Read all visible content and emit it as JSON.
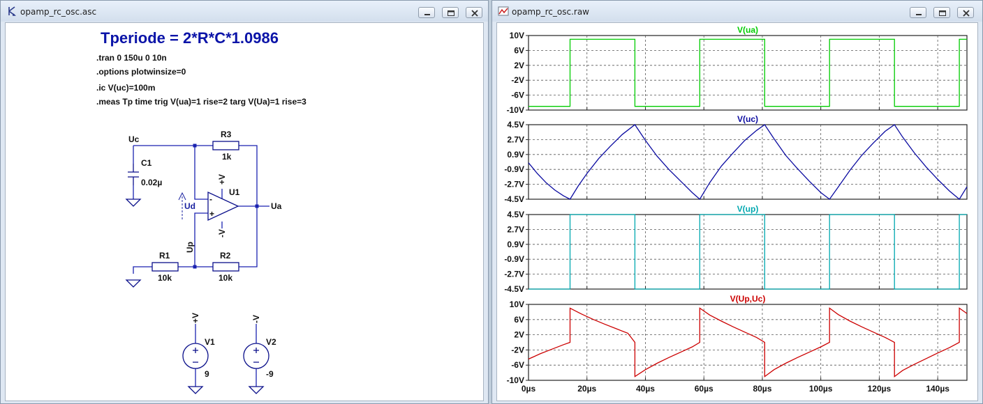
{
  "schematic_window": {
    "title": "opamp_rc_osc.asc",
    "app_icon": "ltspice-schematic-icon",
    "title_text": "Tperiode = 2*R*C*1.0986",
    "directives": [
      ".tran 0 150u 0 10n",
      ".options plotwinsize=0",
      ".ic V(uc)=100m",
      ".meas Tp time trig V(ua)=1 rise=2 targ V(Ua)=1 rise=3"
    ],
    "components": {
      "c1": {
        "name": "C1",
        "value": "0.02µ"
      },
      "r3": {
        "name": "R3",
        "value": "1k"
      },
      "r1": {
        "name": "R1",
        "value": "10k"
      },
      "r2": {
        "name": "R2",
        "value": "10k"
      },
      "u1": {
        "name": "U1",
        "plus_supply": "+V",
        "minus_supply": "-V",
        "in_plus": "+",
        "in_minus": "-"
      },
      "v1": {
        "name": "V1",
        "value": "9",
        "net": "+V"
      },
      "v2": {
        "name": "V2",
        "value": "-9",
        "net": "-V"
      }
    },
    "nets": {
      "uc": "Uc",
      "ua": "Ua",
      "up": "Up",
      "ud": "Ud"
    }
  },
  "waveform_window": {
    "title": "opamp_rc_osc.raw",
    "app_icon": "waveform-viewer-icon",
    "x_ticks": [
      "0µs",
      "20µs",
      "40µs",
      "60µs",
      "80µs",
      "100µs",
      "120µs",
      "140µs"
    ]
  },
  "chart_data": [
    {
      "type": "line",
      "title": "V(ua)",
      "color": "#00cc00",
      "xlim": [
        0,
        150
      ],
      "ylim": [
        -10,
        10
      ],
      "y_ticks": [
        "10V",
        "6V",
        "2V",
        "-2V",
        "-6V",
        "-10V"
      ],
      "y_tick_values": [
        10,
        6,
        2,
        -2,
        -6,
        -10
      ],
      "x_unit": "µs",
      "series": [
        {
          "x": [
            0,
            14.2,
            14.2,
            36.4,
            36.4,
            58.6,
            58.6,
            80.8,
            80.8,
            103,
            103,
            125.2,
            125.2,
            147.4,
            147.4,
            150
          ],
          "y": [
            -9,
            -9,
            9,
            9,
            -9,
            -9,
            9,
            9,
            -9,
            -9,
            9,
            9,
            -9,
            -9,
            9,
            9
          ]
        }
      ]
    },
    {
      "type": "line",
      "title": "V(uc)",
      "color": "#0a0aa0",
      "xlim": [
        0,
        150
      ],
      "ylim": [
        -4.5,
        4.5
      ],
      "y_ticks": [
        "4.5V",
        "2.7V",
        "0.9V",
        "-0.9V",
        "-2.7V",
        "-4.5V"
      ],
      "y_tick_values": [
        4.5,
        2.7,
        0.9,
        -0.9,
        -2.7,
        -4.5
      ],
      "x_unit": "µs",
      "series": [
        {
          "x": [
            0,
            3,
            6,
            9,
            12,
            14.2,
            17,
            20,
            24,
            28,
            32,
            36.4,
            40,
            44,
            48,
            52,
            56,
            58.6,
            62,
            66,
            70,
            74,
            78,
            80.8,
            84,
            88,
            92,
            96,
            100,
            103,
            106,
            110,
            114,
            118,
            122,
            125.2,
            128,
            132,
            136,
            140,
            144,
            147.4,
            150
          ],
          "y": [
            -0.1,
            -1.4,
            -2.5,
            -3.4,
            -4.1,
            -4.5,
            -2.9,
            -1.4,
            0.4,
            1.9,
            3.3,
            4.5,
            2.6,
            0.7,
            -0.9,
            -2.3,
            -3.7,
            -4.5,
            -2.5,
            -0.5,
            1.1,
            2.6,
            3.8,
            4.5,
            2.8,
            0.8,
            -0.8,
            -2.3,
            -3.7,
            -4.5,
            -3.0,
            -1.0,
            0.8,
            2.3,
            3.7,
            4.5,
            3.0,
            1.1,
            -0.6,
            -2.1,
            -3.5,
            -4.5,
            -3.0
          ]
        }
      ]
    },
    {
      "type": "line",
      "title": "V(up)",
      "color": "#00a8b0",
      "xlim": [
        0,
        150
      ],
      "ylim": [
        -4.5,
        4.5
      ],
      "y_ticks": [
        "4.5V",
        "2.7V",
        "0.9V",
        "-0.9V",
        "-2.7V",
        "-4.5V"
      ],
      "y_tick_values": [
        4.5,
        2.7,
        0.9,
        -0.9,
        -2.7,
        -4.5
      ],
      "x_unit": "µs",
      "series": [
        {
          "x": [
            0,
            14.2,
            14.2,
            36.4,
            36.4,
            58.6,
            58.6,
            80.8,
            80.8,
            103,
            103,
            125.2,
            125.2,
            147.4,
            147.4,
            150
          ],
          "y": [
            -4.5,
            -4.5,
            4.5,
            4.5,
            -4.5,
            -4.5,
            4.5,
            4.5,
            -4.5,
            -4.5,
            4.5,
            4.5,
            -4.5,
            -4.5,
            4.5,
            4.5
          ]
        }
      ]
    },
    {
      "type": "line",
      "title": "V(Up,Uc)",
      "color": "#cc0000",
      "xlim": [
        0,
        150
      ],
      "ylim": [
        -10,
        10
      ],
      "y_ticks": [
        "10V",
        "6V",
        "2V",
        "-2V",
        "-6V",
        "-10V"
      ],
      "y_tick_values": [
        10,
        6,
        2,
        -2,
        -6,
        -10
      ],
      "x_unit": "µs",
      "series": [
        {
          "x": [
            0,
            4,
            8,
            12,
            14.2,
            14.2,
            18,
            22,
            26,
            30,
            34,
            36.4,
            36.4,
            40,
            44,
            48,
            52,
            56,
            58.6,
            58.6,
            62,
            66,
            70,
            74,
            78,
            80.8,
            80.8,
            84,
            88,
            92,
            96,
            100,
            103,
            103,
            106,
            110,
            114,
            118,
            122,
            125.2,
            125.2,
            128,
            132,
            136,
            140,
            144,
            147.4,
            147.4,
            150
          ],
          "y": [
            -4.4,
            -3.0,
            -1.8,
            -0.6,
            0.0,
            9.0,
            7.5,
            6.1,
            4.8,
            3.6,
            2.4,
            0.0,
            -9.0,
            -7.2,
            -5.5,
            -4.0,
            -2.6,
            -1.2,
            0.0,
            9.0,
            7.2,
            5.6,
            4.1,
            2.7,
            1.3,
            0.0,
            -9.0,
            -7.2,
            -5.5,
            -4.0,
            -2.6,
            -1.2,
            0.0,
            9.0,
            7.3,
            5.6,
            4.1,
            2.7,
            1.3,
            0.0,
            -9.0,
            -7.4,
            -5.8,
            -4.3,
            -2.8,
            -1.4,
            0.0,
            9.0,
            7.6
          ]
        }
      ]
    }
  ]
}
